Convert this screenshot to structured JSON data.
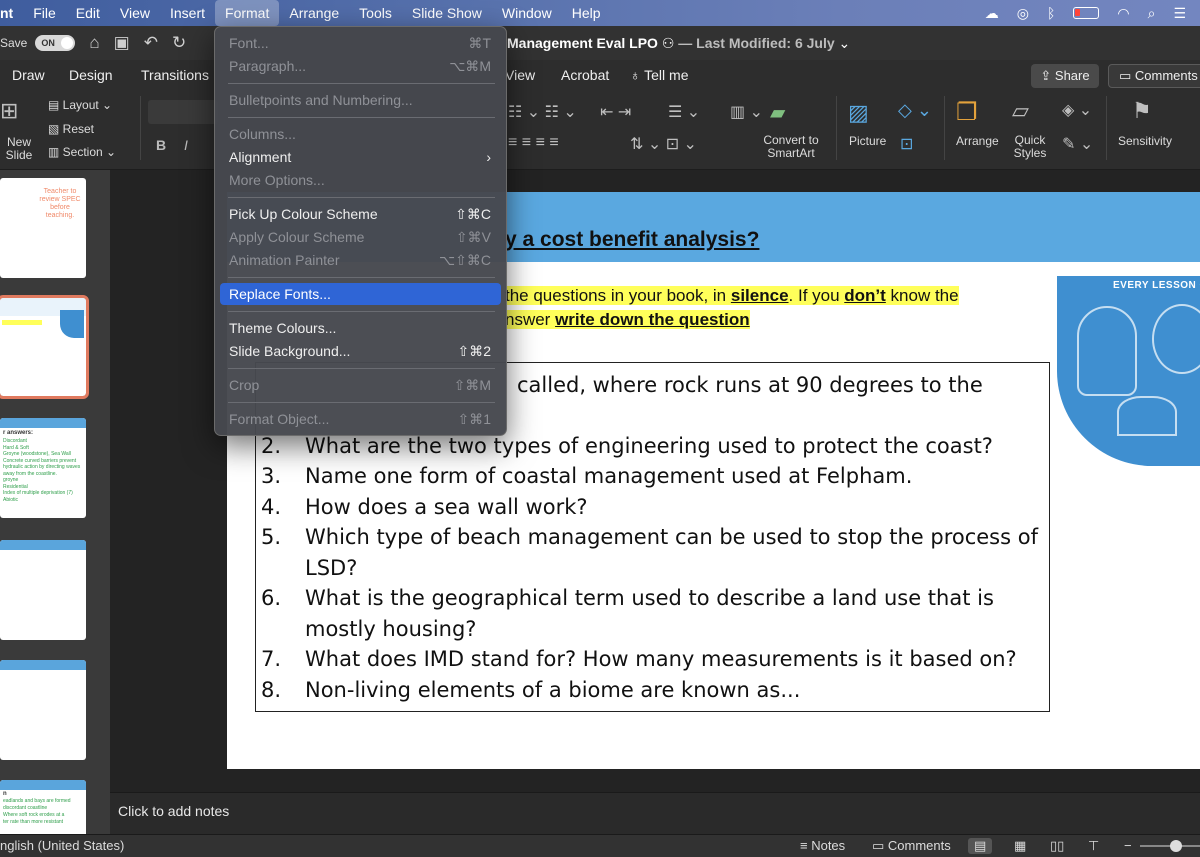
{
  "menubar": {
    "app_fragment": "nt",
    "items": [
      "File",
      "Edit",
      "View",
      "Insert",
      "Format",
      "Arrange",
      "Tools",
      "Slide Show",
      "Window",
      "Help"
    ],
    "active": "Format"
  },
  "titlebar": {
    "autosave_label": "Save",
    "autosave_state": "ON",
    "doc_title": "Management Eval LPO",
    "last_modified": "— Last Modified: 6 July"
  },
  "ribbon_tabs": {
    "left": [
      "Draw",
      "Design",
      "Transitions"
    ],
    "right": [
      "View",
      "Acrobat",
      "Tell me"
    ],
    "share": "Share",
    "comments": "Comments"
  },
  "ribbon": {
    "new_slide": "New Slide",
    "layout": "Layout",
    "reset": "Reset",
    "section": "Section",
    "bold": "B",
    "italic": "I",
    "convert_smartart": "Convert to SmartArt",
    "picture": "Picture",
    "arrange": "Arrange",
    "quick_styles": "Quick Styles",
    "sensitivity": "Sensitivity"
  },
  "format_menu": {
    "items": [
      {
        "label": "Font...",
        "shortcut": "⌘T",
        "disabled": true
      },
      {
        "label": "Paragraph...",
        "shortcut": "⌥⌘M",
        "disabled": true
      },
      {
        "label": "Bulletpoints and Numbering...",
        "shortcut": "",
        "disabled": true
      },
      {
        "label": "Columns...",
        "shortcut": "",
        "disabled": true
      },
      {
        "label": "Alignment",
        "shortcut": "",
        "disabled": false,
        "submenu": true
      },
      {
        "label": "More Options...",
        "shortcut": "",
        "disabled": true
      },
      {
        "label": "Pick Up Colour Scheme",
        "shortcut": "⇧⌘C",
        "disabled": false
      },
      {
        "label": "Apply Colour Scheme",
        "shortcut": "⇧⌘V",
        "disabled": true
      },
      {
        "label": "Animation Painter",
        "shortcut": "⌥⇧⌘C",
        "disabled": true
      },
      {
        "label": "Replace Fonts...",
        "shortcut": "",
        "disabled": false,
        "highlighted": true
      },
      {
        "label": "Theme Colours...",
        "shortcut": "",
        "disabled": false
      },
      {
        "label": "Slide Background...",
        "shortcut": "⇧⌘2",
        "disabled": false
      },
      {
        "label": "Crop",
        "shortcut": "⇧⌘M",
        "disabled": true
      },
      {
        "label": "Format Object...",
        "shortcut": "⇧⌘1",
        "disabled": true
      }
    ]
  },
  "slide": {
    "title_fragment": "y a cost benefit analysis?",
    "instruction_line1_pre": "the questions in your book, in ",
    "instruction_silence": "silence",
    "instruction_line1_mid": ". If you ",
    "instruction_dont": "don’t",
    "instruction_line1_post": " know the",
    "instruction_line2_pre": "nswer ",
    "instruction_line2_bold": "write down the question",
    "questions": [
      {
        "num": "",
        "text": "called, where rock runs at 90 degrees to the"
      },
      {
        "num": "2.",
        "text": "What are the two types of engineering used to protect the coast?"
      },
      {
        "num": "3.",
        "text": "Name one form of coastal management used at Felpham."
      },
      {
        "num": "4.",
        "text": "How does a sea wall work?"
      },
      {
        "num": "5.",
        "text": "Which type of beach management can be used to stop the process of LSD?"
      },
      {
        "num": "6.",
        "text": "What is the geographical term used to describe a land use that is mostly housing?"
      },
      {
        "num": "7.",
        "text": "What does IMD stand for? How many measurements is it based on?"
      },
      {
        "num": "8.",
        "text": "Non-living elements of a biome are known as..."
      }
    ],
    "sticker_text": "EVERY LESSON C"
  },
  "thumbnails": {
    "t1_note": "Teacher to review SPEC before teaching.",
    "t3_heading": "r answers:",
    "t3_lines": [
      "Discordant",
      "Hard & Soft",
      "Groyne (woodstone), Sea Wall",
      "Concrete curved barriers prevent",
      "hydraulic action by directing waves",
      "away from the coastline.",
      "groyne",
      "Residential",
      "Index of multiple deprivation (7)",
      "Abiotic"
    ],
    "t6_heading": "n",
    "t6_lines": [
      "eadlands and bays are formed",
      "discordant coastline",
      "Where soft rock erodes at a",
      "ter rate than more resistant"
    ]
  },
  "notes": {
    "placeholder": "Click to add notes"
  },
  "statusbar": {
    "language": "nglish (United States)",
    "notes": "Notes",
    "comments": "Comments"
  },
  "colors": {
    "menu_highlight": "#2f65d6",
    "slide_header": "#5aa8e0",
    "highlight_yellow": "#ffff5a"
  }
}
